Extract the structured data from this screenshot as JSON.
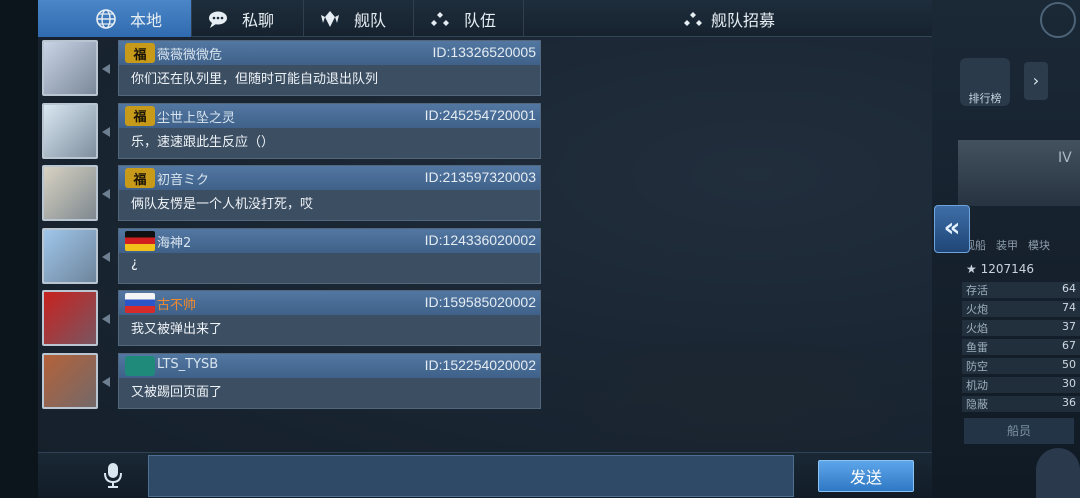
{
  "tabs": {
    "local": "本地",
    "private": "私聊",
    "fleet": "舰队",
    "team": "队伍",
    "recruit": "舰队招募"
  },
  "messages": [
    {
      "badge": "福",
      "badge_type": "fu",
      "name": "薇薇微微危",
      "id": "ID:13326520005",
      "text": "你们还在队列里，但随时可能自动退出队列",
      "avatar_color": "#c9d3e6"
    },
    {
      "badge": "福",
      "badge_type": "fu",
      "name": "尘世上坠之灵",
      "id": "ID:245254720001",
      "text": "乐，速速跟此生反应（）",
      "avatar_color": "#d9e7f2"
    },
    {
      "badge": "福",
      "badge_type": "fu",
      "name": "初音ミク",
      "id": "ID:213597320003",
      "text": "俩队友愣是一个人机没打死，哎",
      "avatar_color": "#d8d2c2"
    },
    {
      "badge": "",
      "badge_type": "flag-de",
      "name": "海神2",
      "id": "ID:124336020002",
      "text": "¿",
      "avatar_color": "#9fc6ea"
    },
    {
      "badge": "",
      "badge_type": "flag-ru",
      "name": "古不帅",
      "name_color": "orange",
      "id": "ID:159585020002",
      "text": "我又被弹出来了",
      "avatar_color": "#c7221f"
    },
    {
      "badge": "",
      "badge_type": "flag-team",
      "name": "LTS_TYSB",
      "id": "ID:152254020002",
      "text": "又被踢回页面了",
      "avatar_color": "#b4623a"
    }
  ],
  "input": {
    "placeholder": "",
    "value": ""
  },
  "send_label": "发送",
  "right_panel": {
    "rank_label": "排行榜",
    "tier": "IV",
    "tabs": [
      "舰船",
      "装甲",
      "模块"
    ],
    "power": "★ 1207146",
    "stats": [
      {
        "label": "存活",
        "value": "64"
      },
      {
        "label": "火炮",
        "value": "74"
      },
      {
        "label": "火焰",
        "value": "37"
      },
      {
        "label": "鱼雷",
        "value": "67"
      },
      {
        "label": "防空",
        "value": "50"
      },
      {
        "label": "机动",
        "value": "30"
      },
      {
        "label": "隐蔽",
        "value": "36"
      }
    ],
    "crew_label": "船员"
  },
  "colors": {
    "accent": "#3a78bd",
    "bubble": "#3c4e62",
    "orange_name": "#f08a2e"
  }
}
